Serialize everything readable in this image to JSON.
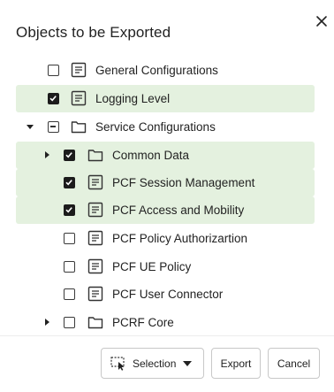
{
  "dialog": {
    "title": "Objects to be Exported"
  },
  "tree": {
    "items": [
      {
        "label": "General Configurations",
        "type": "file",
        "state": "unchecked",
        "toggle": "none",
        "selected": false
      },
      {
        "label": "Logging Level",
        "type": "file",
        "state": "checked",
        "toggle": "none",
        "selected": true
      },
      {
        "label": "Service Configurations",
        "type": "folder",
        "state": "partial",
        "toggle": "expanded",
        "selected": false
      },
      {
        "label": "Common Data",
        "type": "folder",
        "state": "checked",
        "toggle": "collapsed",
        "selected": true
      },
      {
        "label": "PCF Session Management",
        "type": "file",
        "state": "checked",
        "toggle": "none",
        "selected": true
      },
      {
        "label": "PCF Access and Mobility",
        "type": "file",
        "state": "checked",
        "toggle": "none",
        "selected": true
      },
      {
        "label": "PCF Policy Authorizartion",
        "type": "file",
        "state": "unchecked",
        "toggle": "none",
        "selected": false
      },
      {
        "label": "PCF UE Policy",
        "type": "file",
        "state": "unchecked",
        "toggle": "none",
        "selected": false
      },
      {
        "label": "PCF User Connector",
        "type": "file",
        "state": "unchecked",
        "toggle": "none",
        "selected": false
      },
      {
        "label": "PCRF Core",
        "type": "folder",
        "state": "unchecked",
        "toggle": "collapsed",
        "selected": false
      }
    ]
  },
  "footer": {
    "selection_label": "Selection",
    "export_label": "Export",
    "cancel_label": "Cancel"
  },
  "colors": {
    "selected_row_bg": "#e4f1df",
    "checkbox_checked": "#1c1c1c"
  }
}
